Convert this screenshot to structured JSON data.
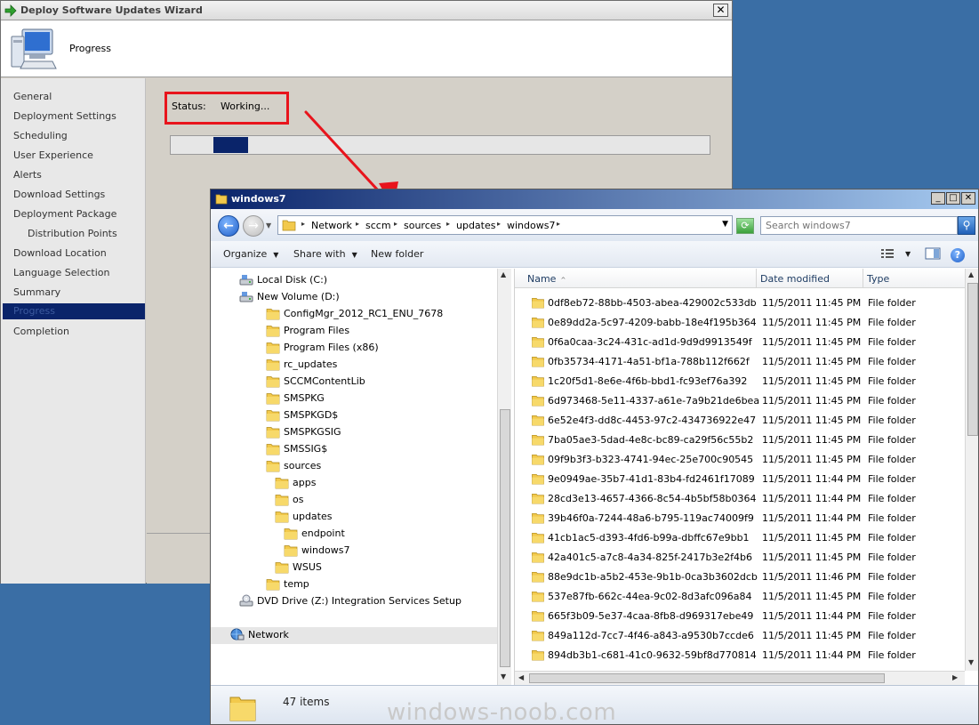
{
  "colors": {
    "desktop": "#3a6ea5",
    "highlight_red": "#e8141c",
    "selection_navy": "#0a246a",
    "folder_yellow": "#f2c94c"
  },
  "wizard": {
    "title": "Deploy Software Updates Wizard",
    "close_glyph": "✕",
    "page_title": "Progress",
    "nav_items": [
      {
        "label": "General"
      },
      {
        "label": "Deployment Settings"
      },
      {
        "label": "Scheduling"
      },
      {
        "label": "User Experience"
      },
      {
        "label": "Alerts"
      },
      {
        "label": "Download Settings"
      },
      {
        "label": "Deployment Package"
      },
      {
        "label": "Distribution Points"
      },
      {
        "label": "Download Location"
      },
      {
        "label": "Language Selection"
      },
      {
        "label": "Summary"
      },
      {
        "label": "Progress"
      },
      {
        "label": "Completion"
      }
    ],
    "status_label": "Status:",
    "status_value": "Working...",
    "progress_fill_fraction": 0.065
  },
  "explorer": {
    "title": "windows7",
    "breadcrumbs": [
      "Network",
      "sccm",
      "sources",
      "updates",
      "windows7"
    ],
    "crumb_separator": "▸",
    "search_placeholder": "Search windows7",
    "toolbar": {
      "organize": "Organize",
      "share_with": "Share with",
      "new_folder": "New folder",
      "caret": "▼",
      "help": "?"
    },
    "tree": [
      {
        "label": "Local Disk (C:)",
        "icon": "drive-icon"
      },
      {
        "label": "New Volume (D:)",
        "icon": "drive-icon"
      },
      {
        "label": "ConfigMgr_2012_RC1_ENU_7678",
        "icon": "folder-icon"
      },
      {
        "label": "Program Files",
        "icon": "folder-icon"
      },
      {
        "label": "Program Files (x86)",
        "icon": "folder-icon"
      },
      {
        "label": "rc_updates",
        "icon": "folder-icon"
      },
      {
        "label": "SCCMContentLib",
        "icon": "folder-icon"
      },
      {
        "label": "SMSPKG",
        "icon": "folder-icon"
      },
      {
        "label": "SMSPKGD$",
        "icon": "folder-icon"
      },
      {
        "label": "SMSPKGSIG",
        "icon": "folder-icon"
      },
      {
        "label": "SMSSIG$",
        "icon": "folder-icon"
      },
      {
        "label": "sources",
        "icon": "folder-icon"
      },
      {
        "label": "apps",
        "icon": "folder-icon"
      },
      {
        "label": "os",
        "icon": "folder-icon"
      },
      {
        "label": "updates",
        "icon": "folder-icon"
      },
      {
        "label": "endpoint",
        "icon": "folder-icon"
      },
      {
        "label": "windows7",
        "icon": "folder-icon"
      },
      {
        "label": "WSUS",
        "icon": "folder-icon"
      },
      {
        "label": "temp",
        "icon": "folder-icon"
      },
      {
        "label": "DVD Drive (Z:) Integration Services Setup",
        "icon": "dvd-icon"
      },
      {
        "label": "Network",
        "icon": "network-icon"
      }
    ],
    "columns": {
      "name": "Name",
      "date": "Date modified",
      "type": "Type",
      "sort_glyph": "^"
    },
    "files": [
      {
        "name": "0df8eb72-88bb-4503-abea-429002c533db",
        "date": "11/5/2011 11:45 PM",
        "type": "File folder"
      },
      {
        "name": "0e89dd2a-5c97-4209-babb-18e4f195b364",
        "date": "11/5/2011 11:45 PM",
        "type": "File folder"
      },
      {
        "name": "0f6a0caa-3c24-431c-ad1d-9d9d9913549f",
        "date": "11/5/2011 11:45 PM",
        "type": "File folder"
      },
      {
        "name": "0fb35734-4171-4a51-bf1a-788b112f662f",
        "date": "11/5/2011 11:45 PM",
        "type": "File folder"
      },
      {
        "name": "1c20f5d1-8e6e-4f6b-bbd1-fc93ef76a392",
        "date": "11/5/2011 11:45 PM",
        "type": "File folder"
      },
      {
        "name": "6d973468-5e11-4337-a61e-7a9b21de6bea",
        "date": "11/5/2011 11:45 PM",
        "type": "File folder"
      },
      {
        "name": "6e52e4f3-dd8c-4453-97c2-434736922e47",
        "date": "11/5/2011 11:45 PM",
        "type": "File folder"
      },
      {
        "name": "7ba05ae3-5dad-4e8c-bc89-ca29f56c55b2",
        "date": "11/5/2011 11:45 PM",
        "type": "File folder"
      },
      {
        "name": "09f9b3f3-b323-4741-94ec-25e700c90545",
        "date": "11/5/2011 11:45 PM",
        "type": "File folder"
      },
      {
        "name": "9e0949ae-35b7-41d1-83b4-fd2461f17089",
        "date": "11/5/2011 11:44 PM",
        "type": "File folder"
      },
      {
        "name": "28cd3e13-4657-4366-8c54-4b5bf58b0364",
        "date": "11/5/2011 11:44 PM",
        "type": "File folder"
      },
      {
        "name": "39b46f0a-7244-48a6-b795-119ac74009f9",
        "date": "11/5/2011 11:44 PM",
        "type": "File folder"
      },
      {
        "name": "41cb1ac5-d393-4fd6-b99a-dbffc67e9bb1",
        "date": "11/5/2011 11:45 PM",
        "type": "File folder"
      },
      {
        "name": "42a401c5-a7c8-4a34-825f-2417b3e2f4b6",
        "date": "11/5/2011 11:45 PM",
        "type": "File folder"
      },
      {
        "name": "88e9dc1b-a5b2-453e-9b1b-0ca3b3602dcb",
        "date": "11/5/2011 11:46 PM",
        "type": "File folder"
      },
      {
        "name": "537e87fb-662c-44ea-9c02-8d3afc096a84",
        "date": "11/5/2011 11:45 PM",
        "type": "File folder"
      },
      {
        "name": "665f3b09-5e37-4caa-8fb8-d969317ebe49",
        "date": "11/5/2011 11:44 PM",
        "type": "File folder"
      },
      {
        "name": "849a112d-7cc7-4f46-a843-a9530b7ccde6",
        "date": "11/5/2011 11:45 PM",
        "type": "File folder"
      },
      {
        "name": "894db3b1-c681-41c0-9632-59bf8d770814",
        "date": "11/5/2011 11:44 PM",
        "type": "File folder"
      }
    ],
    "item_count": "47 items",
    "watermark": "windows-noob.com"
  }
}
